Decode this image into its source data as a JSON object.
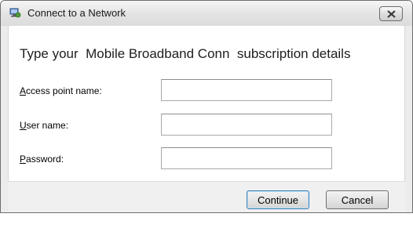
{
  "window": {
    "title": "Connect to a Network",
    "icon": "network-globe-icon"
  },
  "heading": "Type your  Mobile Broadband Conn  subscription details",
  "fields": [
    {
      "label_accel": "A",
      "label_rest": "ccess point name:",
      "value": ""
    },
    {
      "label_accel": "U",
      "label_rest": "ser name:",
      "value": ""
    },
    {
      "label_accel": "P",
      "label_rest": "assword:",
      "value": ""
    }
  ],
  "buttons": {
    "continue": "Continue",
    "cancel": "Cancel"
  }
}
